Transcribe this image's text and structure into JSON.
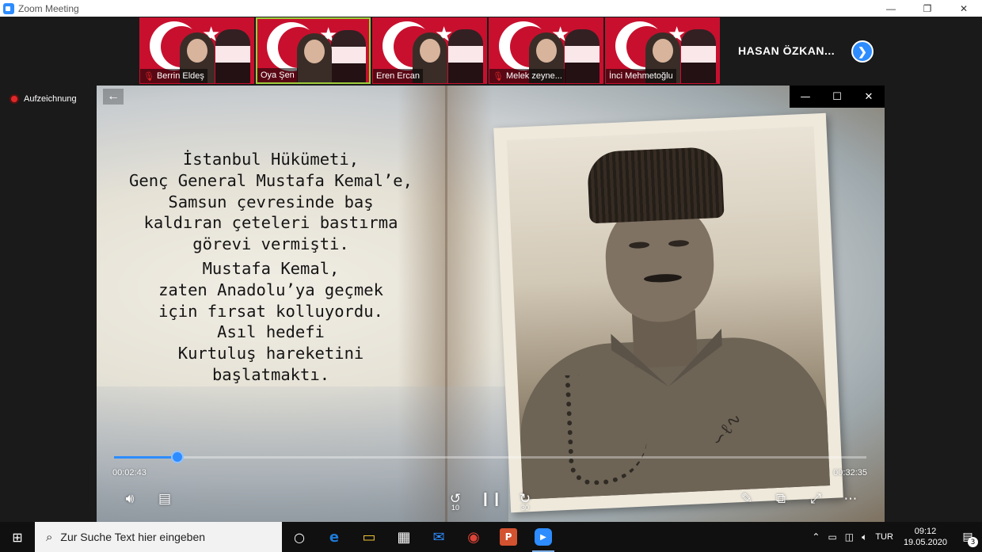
{
  "window": {
    "title": "Zoom Meeting",
    "minimize_glyph": "—",
    "restore_glyph": "❐",
    "close_glyph": "✕"
  },
  "participants": [
    {
      "name": "Berrin Eldeş",
      "muted": true
    },
    {
      "name": "Oya Şen",
      "muted": false,
      "active": true
    },
    {
      "name": "Eren Ercan",
      "muted": false
    },
    {
      "name": "Melek zeyne...",
      "muted": true
    },
    {
      "name": "İnci Mehmetoğlu",
      "muted": false
    }
  ],
  "featured_participant": "HASAN ÖZKAN...",
  "next_page_icon": "chevron-right-icon",
  "recording": {
    "label": "Aufzeichnung",
    "color": "#e02828"
  },
  "player": {
    "back_glyph": "←",
    "minimize_glyph": "—",
    "maximize_glyph": "☐",
    "close_glyph": "✕",
    "poem_lines": [
      "İstanbul Hükümeti,",
      "Genç General Mustafa Kemal’e,",
      "Samsun çevresinde baş",
      "kaldıran çeteleri bastırma",
      "görevi vermişti.",
      "Mustafa Kemal,",
      "zaten Anadolu’ya geçmek",
      "için fırsat kolluyordu.",
      "Asıl hedefi",
      "Kurtuluş hareketini başlatmaktı."
    ],
    "current_time": "00:02:43",
    "total_time": "00:32:35",
    "progress_fraction": 0.084,
    "skip_back": "10",
    "skip_forward": "30",
    "accent": "#2d8cff"
  },
  "taskbar": {
    "search_placeholder": "Zur Suche Text hier eingeben",
    "apps": [
      {
        "icon": "cortana-icon",
        "glyph": "○"
      },
      {
        "icon": "edge-icon",
        "glyph": "e",
        "color": "#1e7bd8"
      },
      {
        "icon": "file-explorer-icon",
        "glyph": "▭",
        "color": "#f1c232"
      },
      {
        "icon": "store-icon",
        "glyph": "▦",
        "color": "#ffffff"
      },
      {
        "icon": "mail-icon",
        "glyph": "✉",
        "color": "#2d8cff"
      },
      {
        "icon": "chrome-icon",
        "glyph": "◉",
        "color": "#db4437"
      },
      {
        "icon": "powerpoint-icon",
        "glyph": "P",
        "color": "#d35230"
      },
      {
        "icon": "zoom-icon",
        "glyph": "▶",
        "color": "#2d8cff",
        "open": true
      }
    ],
    "tray_language": "TUR",
    "time": "09:12",
    "date": "19.05.2020",
    "notification_count": "3"
  }
}
